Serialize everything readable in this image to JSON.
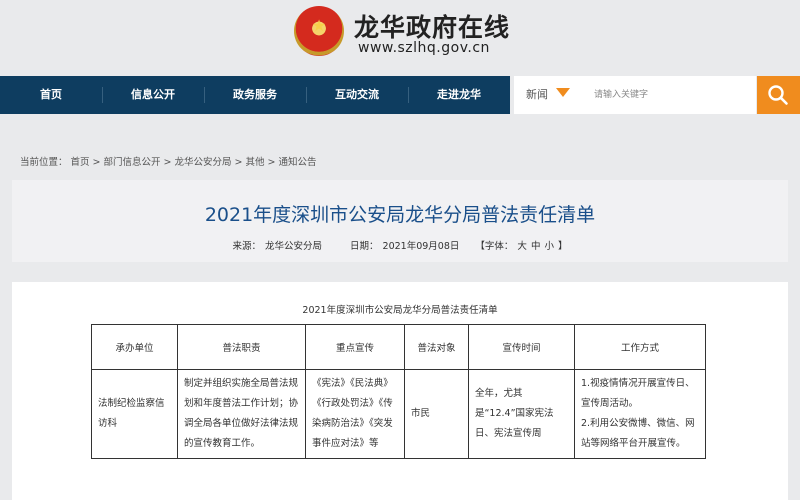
{
  "header": {
    "site_title": "龙华政府在线",
    "site_url": "www.szlhq.gov.cn"
  },
  "nav": {
    "items": [
      {
        "label": "首页"
      },
      {
        "label": "信息公开"
      },
      {
        "label": "政务服务"
      },
      {
        "label": "互动交流"
      },
      {
        "label": "走进龙华"
      }
    ]
  },
  "search": {
    "scope_label": "新闻",
    "placeholder": "请输入关键字",
    "accent_color": "#f08c1e"
  },
  "breadcrumb": {
    "prefix": "当前位置：",
    "items": [
      "首页",
      "部门信息公开",
      "龙华公安分局",
      "其他",
      "通知公告"
    ],
    "separator": ">"
  },
  "article": {
    "title": "2021年度深圳市公安局龙华分局普法责任清单",
    "source_label": "来源：",
    "source_value": "龙华公安分局",
    "date_label": "日期：",
    "date_value": "2021年09月08日",
    "font_label": "【字体：",
    "font_sizes": [
      "大",
      "中",
      "小"
    ],
    "font_close": "】"
  },
  "table": {
    "caption": "2021年度深圳市公安局龙华分局普法责任清单",
    "headers": [
      "承办单位",
      "普法职责",
      "重点宣传",
      "普法对象",
      "宣传时间",
      "工作方式"
    ],
    "rows": [
      [
        "法制纪检监察信访科",
        "制定并组织实施全局普法规划和年度普法工作计划；协调全局各单位做好法律法规的宣传教育工作。",
        "《宪法》《民法典》《行政处罚法》《传染病防治法》《突发事件应对法》等",
        "市民",
        "全年，尤其是“12.4”国家宪法日、宪法宣传周",
        "1.视疫情情况开展宣传日、宣传周活动。\n2.利用公安微博、微信、网站等网络平台开展宣传。"
      ]
    ]
  },
  "colors": {
    "nav_bg": "#0e3d60",
    "title_color": "#1a4f8a",
    "page_bg": "#e9eaec"
  }
}
